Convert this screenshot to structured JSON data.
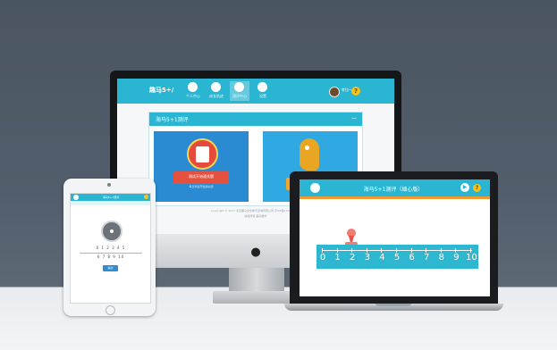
{
  "desktop": {
    "brand": "趣马5÷/",
    "nav": [
      {
        "label": "个人中心",
        "icon": "user-icon"
      },
      {
        "label": "成长轨迹",
        "icon": "book-icon"
      },
      {
        "label": "测评中心",
        "icon": "chart-icon"
      },
      {
        "label": "设置",
        "icon": "gear-icon"
      }
    ],
    "user_name": "考拉~",
    "help": "?",
    "panel_title": "海马5+1测评",
    "panel_ctrl": "—",
    "start_button": "测试开始通关题",
    "start_sub": "每日测试开始通关题",
    "footer_line1": "Copyright © 2017 北京趣马文化教育咨询有限公司 京ICP备12345678号",
    "footer_line2": "版权所有 趣马数学"
  },
  "tablet": {
    "title": "海马5+1测评",
    "row1": "0 1 2 3 4 5",
    "row2": "6 7 8 9 10",
    "button": "提交"
  },
  "laptop": {
    "title": "海马5+1测评（细心版）",
    "play": "▶",
    "help": "?",
    "ruler_labels": [
      "0",
      "1",
      "2",
      "3",
      "4",
      "5",
      "6",
      "7",
      "8",
      "9",
      "10"
    ]
  },
  "colors": {
    "accent": "#2ab6d2",
    "orange": "#f29a32",
    "yellow": "#f6c21b",
    "red": "#e44b3b"
  },
  "marker_value": 2
}
